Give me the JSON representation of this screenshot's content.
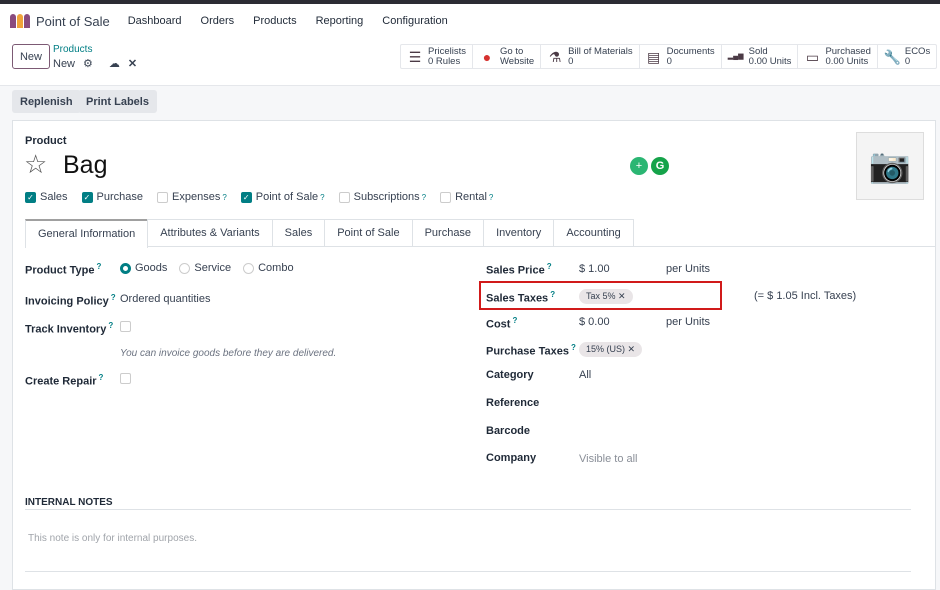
{
  "nav": {
    "app": "Point of Sale",
    "menu": [
      "Dashboard",
      "Orders",
      "Products",
      "Reporting",
      "Configuration"
    ]
  },
  "control": {
    "new_label": "New",
    "breadcrumb": "Products",
    "record": "New"
  },
  "stats": [
    {
      "icon": "list-icon",
      "l1": "Pricelists",
      "l2": "0 Rules"
    },
    {
      "icon": "globe-icon",
      "l1": "Go to",
      "l2": "Website"
    },
    {
      "icon": "flask-icon",
      "l1": "Bill of Materials",
      "l2": "0"
    },
    {
      "icon": "document-icon",
      "l1": "Documents",
      "l2": "0"
    },
    {
      "icon": "bar-chart-icon",
      "l1": "Sold",
      "l2": "0.00 Units"
    },
    {
      "icon": "credit-card-icon",
      "l1": "Purchased",
      "l2": "0.00 Units"
    },
    {
      "icon": "wrench-icon",
      "l1": "ECOs",
      "l2": "0"
    }
  ],
  "actions": {
    "replenish": "Replenish",
    "print": "Print Labels"
  },
  "product": {
    "label": "Product",
    "name": "Bag"
  },
  "flags": [
    {
      "label": "Sales",
      "checked": true,
      "help": false
    },
    {
      "label": "Purchase",
      "checked": true,
      "help": false
    },
    {
      "label": "Expenses",
      "checked": false,
      "help": true
    },
    {
      "label": "Point of Sale",
      "checked": true,
      "help": true
    },
    {
      "label": "Subscriptions",
      "checked": false,
      "help": true
    },
    {
      "label": "Rental",
      "checked": false,
      "help": true
    }
  ],
  "tabs": [
    "General Information",
    "Attributes & Variants",
    "Sales",
    "Point of Sale",
    "Purchase",
    "Inventory",
    "Accounting"
  ],
  "left": {
    "product_type_label": "Product Type",
    "types": [
      "Goods",
      "Service",
      "Combo"
    ],
    "invoicing_label": "Invoicing Policy",
    "invoicing_value": "Ordered quantities",
    "track_label": "Track Inventory",
    "hint": "You can invoice goods before they are delivered.",
    "repair_label": "Create Repair"
  },
  "right": {
    "sales_price_label": "Sales Price",
    "sales_price": "$ 1.00",
    "per1": "per Units",
    "sales_taxes_label": "Sales Taxes",
    "sales_tax": "Tax 5%",
    "incl": "(= $ 1.05 Incl. Taxes)",
    "cost_label": "Cost",
    "cost": "$ 0.00",
    "per2": "per Units",
    "purchase_taxes_label": "Purchase Taxes",
    "purchase_tax": "15% (US)",
    "category_label": "Category",
    "category": "All",
    "reference_label": "Reference",
    "barcode_label": "Barcode",
    "company_label": "Company",
    "company_placeholder": "Visible to all"
  },
  "notes": {
    "title": "INTERNAL NOTES",
    "placeholder": "This note is only for internal purposes."
  },
  "help": "?",
  "remove": "✕"
}
